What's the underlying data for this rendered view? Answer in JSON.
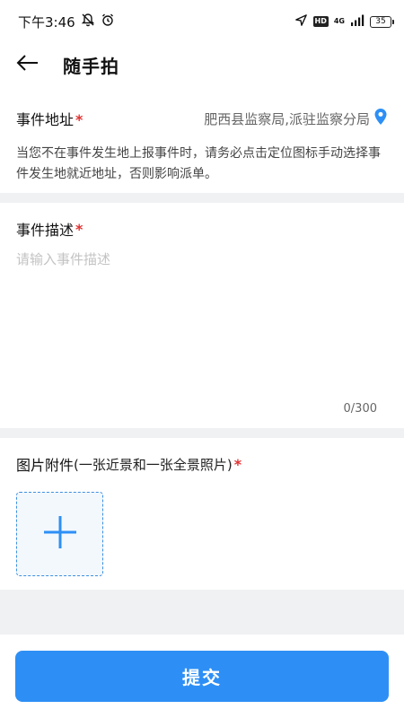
{
  "status_bar": {
    "time": "下午3:46",
    "hd": "HD",
    "network": "4G",
    "battery": "35",
    "icons": [
      "bell-off-icon",
      "alarm-icon",
      "location-arrow-icon",
      "signal-icon"
    ]
  },
  "header": {
    "back_icon": "arrow-left-icon",
    "title": "随手拍"
  },
  "address": {
    "label": "事件地址",
    "required_mark": "*",
    "value": "肥西县监察局,派驻监察分局",
    "icon": "location-pin-icon",
    "hint": "当您不在事件发生地上报事件时，请务必点击定位图标手动选择事件发生地就近地址，否则影响派单。"
  },
  "description": {
    "label": "事件描述",
    "required_mark": "*",
    "placeholder": "请输入事件描述",
    "value": "",
    "counter": "0/300"
  },
  "attachments": {
    "label": "图片附件",
    "sublabel": "(一张近景和一张全景照片)",
    "required_mark": "*",
    "add_icon": "plus-icon"
  },
  "submit": {
    "label": "提交"
  },
  "colors": {
    "accent": "#2d8ff5",
    "required": "#e03131",
    "separator": "#f0f1f3",
    "upload_border": "#3d8fe0"
  }
}
